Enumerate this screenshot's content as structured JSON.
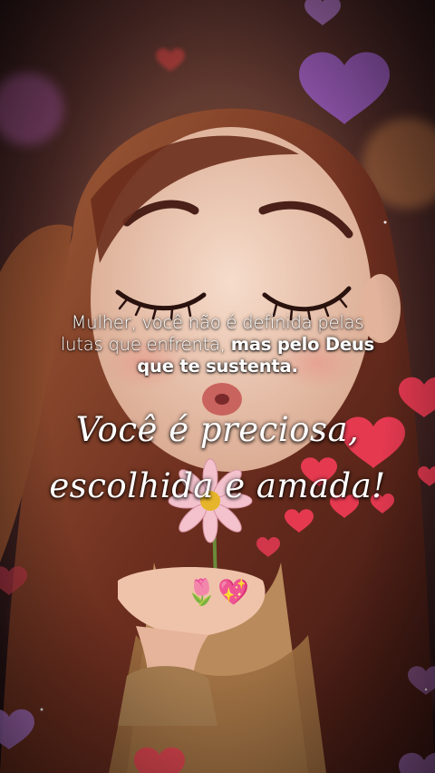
{
  "caption": {
    "line1": "Mulher, você não é definida pelas",
    "line2_regular": "lutas que enfrenta, ",
    "line2_bold": "mas pelo Deus",
    "line3_bold": "que te sustenta."
  },
  "script": {
    "line1": "Você é preciosa,",
    "line2": "escolhida e amada!"
  },
  "emoji": "🌷💖",
  "colors": {
    "heart_red": "#e53950",
    "heart_purple": "#a463d8",
    "hair": "#7a3b24",
    "skin": "#f0cdb9"
  }
}
